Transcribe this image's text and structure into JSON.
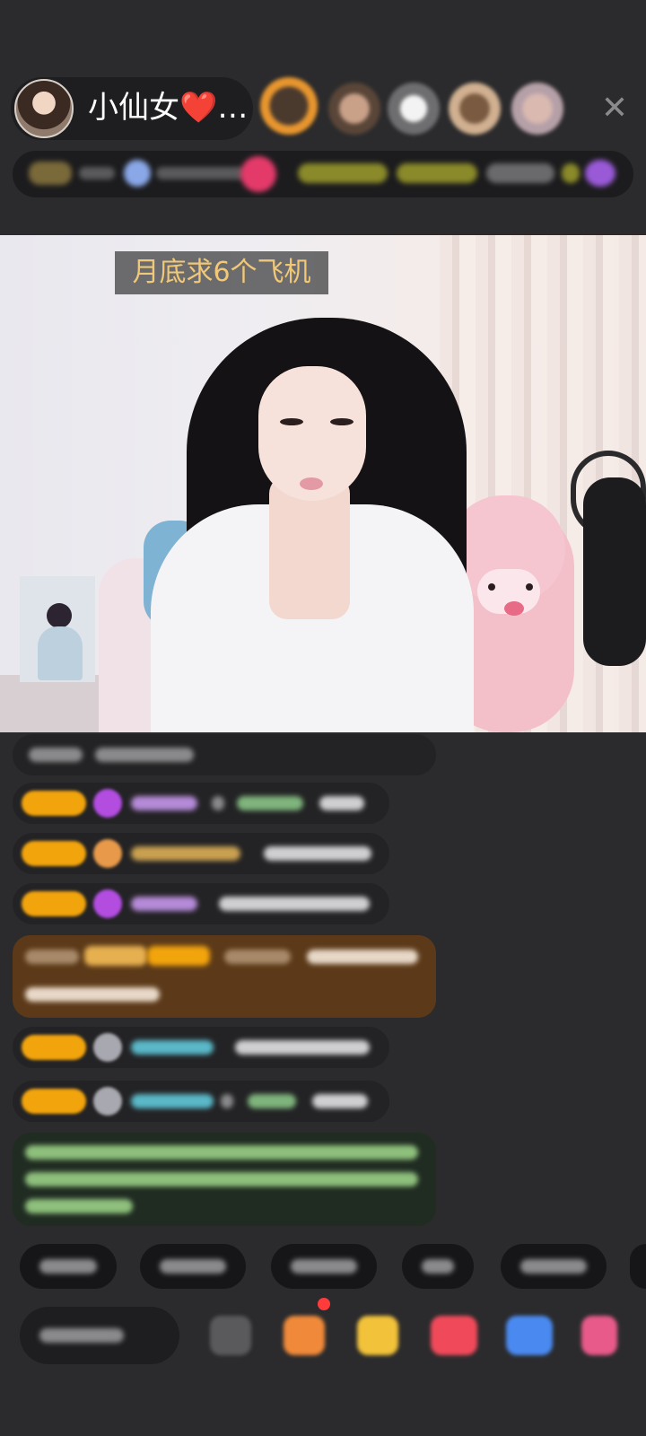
{
  "host": {
    "name": "小仙女❤️…"
  },
  "video": {
    "overlay_title": "月底求6个飞机"
  },
  "icons": {
    "close": "close-icon",
    "gift": "gift-icon",
    "more": "more-icon"
  },
  "colors": {
    "background": "#2b2b2d",
    "overlay_title_text": "#f0c877",
    "level_badge": "#f2a40d",
    "special_message_bg": "#5c3a19"
  }
}
